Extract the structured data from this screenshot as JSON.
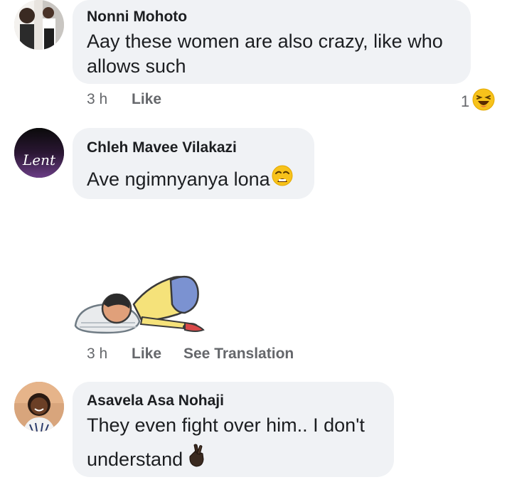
{
  "comments": [
    {
      "author": "Nonni Mohoto",
      "text_line1": "Aay these women are also crazy, like who",
      "text_line2": "allows such",
      "time": "3 h",
      "like_label": "Like",
      "reaction_count": "1",
      "reaction_icon": "laughing-emoji-icon"
    },
    {
      "author": "Chleh Mavee Vilakazi",
      "text": "Ave ngimnyanya lona",
      "text_emoji": "weary-face-emoji-icon",
      "avatar_text": "Lent",
      "sticker_icon": "bowing-person-sticker",
      "time": "3 h",
      "like_label": "Like",
      "translation_label": "See Translation"
    },
    {
      "author": "Asavela Asa Nohaji",
      "text_line1": "They even fight over him.. I don't",
      "text_line2": "understand",
      "text_emoji": "crossed-fingers-emoji-icon"
    }
  ],
  "colors": {
    "bubble": "#f0f2f5",
    "meta_text": "#65676b",
    "primary_text": "#1c1e21"
  }
}
